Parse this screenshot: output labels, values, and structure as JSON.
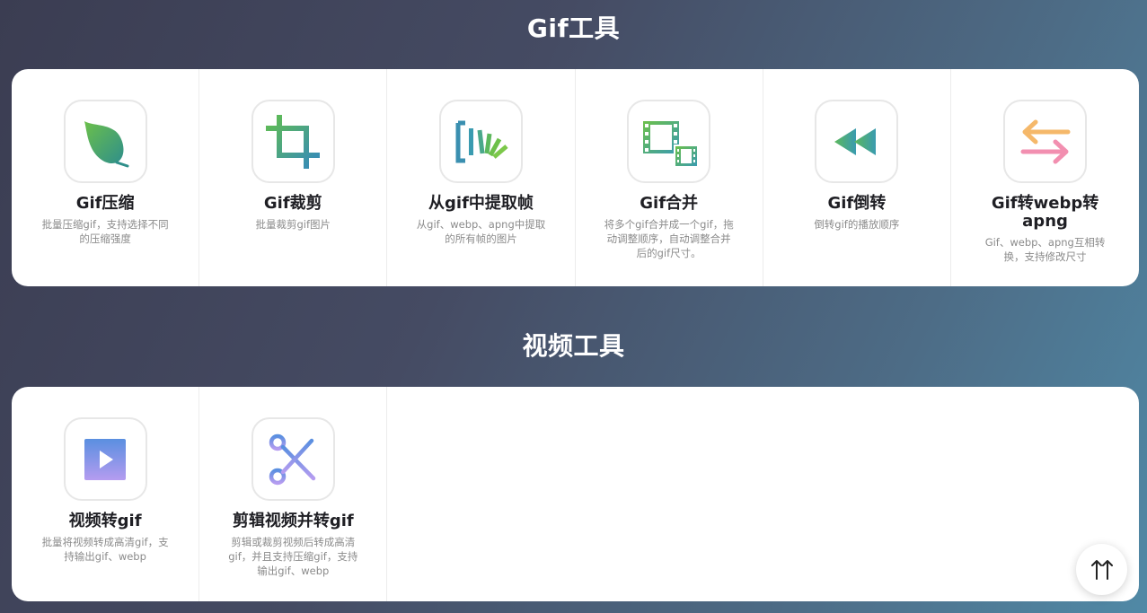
{
  "gif_section": {
    "title": "Gif工具",
    "tools": [
      {
        "name": "Gif压缩",
        "desc": "批量压缩gif，支持选择不同的压缩强度",
        "icon": "leaf-icon"
      },
      {
        "name": "Gif裁剪",
        "desc": "批量裁剪gif图片",
        "icon": "crop-icon"
      },
      {
        "name": "从gif中提取帧",
        "desc": "从gif、webp、apng中提取的所有帧的图片",
        "icon": "frames-extract-icon"
      },
      {
        "name": "Gif合并",
        "desc": "将多个gif合并成一个gif，拖动调整顺序，自动调整合并后的gif尺寸。",
        "icon": "film-merge-icon"
      },
      {
        "name": "Gif倒转",
        "desc": "倒转gif的播放顺序",
        "icon": "rewind-icon"
      },
      {
        "name": "Gif转webp转apng",
        "desc": "Gif、webp、apng互相转换，支持修改尺寸",
        "icon": "swap-arrows-icon"
      }
    ]
  },
  "video_section": {
    "title": "视频工具",
    "tools": [
      {
        "name": "视频转gif",
        "desc": "批量将视频转成高清gif，支持输出gif、webp",
        "icon": "play-video-icon"
      },
      {
        "name": "剪辑视频并转gif",
        "desc": "剪辑或裁剪视频后转成高清gif，并且支持压缩gif，支持输出gif、webp",
        "icon": "scissors-icon"
      }
    ]
  },
  "back_to_top": {
    "icon": "back-to-top-icon",
    "glyph": "⇈"
  },
  "colors": {
    "green": "#5cb85c",
    "teal": "#3a9bb0",
    "pink": "#f28fb0",
    "orange": "#f5b86a",
    "purple": "#b59cf0",
    "blue": "#5a8fe0"
  }
}
